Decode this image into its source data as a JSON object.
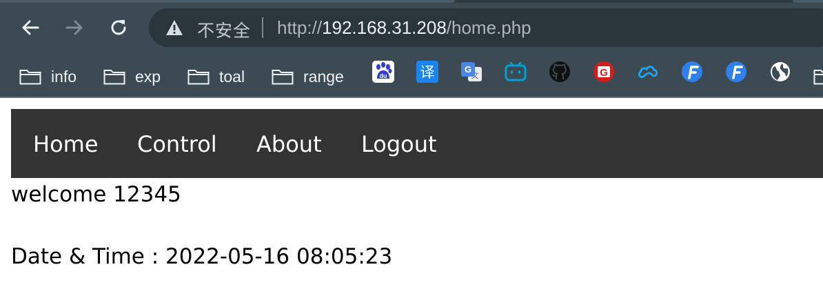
{
  "browser": {
    "security_label": "不安全",
    "url_scheme": "http://",
    "url_host": "192.168.31.208",
    "url_path": "/home.php",
    "icons": [
      "back-icon",
      "forward-icon",
      "reload-icon",
      "warning-icon"
    ]
  },
  "bookmarks": {
    "folders": [
      {
        "label": "info"
      },
      {
        "label": "exp"
      },
      {
        "label": "toal"
      },
      {
        "label": "range"
      }
    ],
    "icons": [
      {
        "name": "baidu-icon",
        "color": "#2f3cd6"
      },
      {
        "name": "translate-icon",
        "glyph": "译",
        "color": "#1b84f0"
      },
      {
        "name": "google-translate-icon",
        "color": "#4a86e8"
      },
      {
        "name": "bilibili-icon",
        "color": "#00a1d6"
      },
      {
        "name": "github-icon",
        "color": "#111111"
      },
      {
        "name": "g-logo-icon",
        "glyph": "G",
        "color": "#d71a1a"
      },
      {
        "name": "cloud-icon",
        "color": "#1ea7f0"
      },
      {
        "name": "f-logo-icon",
        "glyph": "F",
        "color": "#2f80ed"
      },
      {
        "name": "f-logo-icon-2",
        "glyph": "F",
        "color": "#2f80ed"
      },
      {
        "name": "globe-icon",
        "color": "#ffffff"
      }
    ]
  },
  "nav": {
    "items": [
      {
        "label": "Home"
      },
      {
        "label": "Control"
      },
      {
        "label": "About"
      },
      {
        "label": "Logout"
      }
    ],
    "background": "#333333"
  },
  "content": {
    "welcome": "welcome 12345",
    "datetime": "Date & Time : 2022-05-16 08:05:23"
  }
}
